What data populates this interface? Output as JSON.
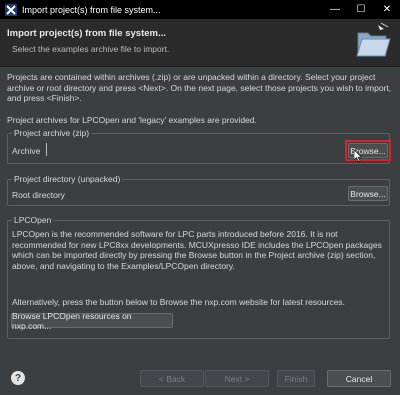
{
  "window": {
    "title": "Import project(s) from file system...",
    "icon": "mcuxpresso-x-icon",
    "controls": {
      "minimize": "—",
      "maximize": "☐",
      "close": "✕"
    }
  },
  "banner": {
    "title": "Import project(s) from file system...",
    "subtitle": "Select the examples archive file to import.",
    "icon": "open-folder-icon"
  },
  "intro": {
    "text": "Projects are contained within archives (.zip) or are unpacked within a directory. Select your project archive or root directory and press <Next>. On the next page, select those projects you wish to import, and press <Finish>.",
    "note": "Project archives for LPCOpen and 'legacy' examples are provided."
  },
  "archive_group": {
    "title": "Project archive (zip)",
    "label": "Archive",
    "value": "",
    "browse_label": "Browse..."
  },
  "directory_group": {
    "title": "Project directory (unpacked)",
    "label": "Root directory",
    "value": "",
    "browse_label": "Browse..."
  },
  "lpcopen_group": {
    "title": "LPCOpen",
    "text": "LPCOpen is the recommended software for LPC parts introduced before 2016. It is not recommended for new LPC8xx developments. MCUXpresso IDE includes the LPCOpen packages which can be imported directly by pressing the Browse button in the Project archive (zip) section, above, and navigating to the Examples/LPCOpen directory.",
    "alt_text": "Alternatively, press the button below to Browse the nxp.com website for latest resources.",
    "button_label": "Browse LPCOpen resources on nxp.com..."
  },
  "footer": {
    "help_label": "?",
    "back_label": "< Back",
    "next_label": "Next >",
    "finish_label": "Finish",
    "cancel_label": "Cancel"
  },
  "colors": {
    "highlight": "#d8232a",
    "background": "#3c3f41",
    "titlebar": "#000000"
  }
}
